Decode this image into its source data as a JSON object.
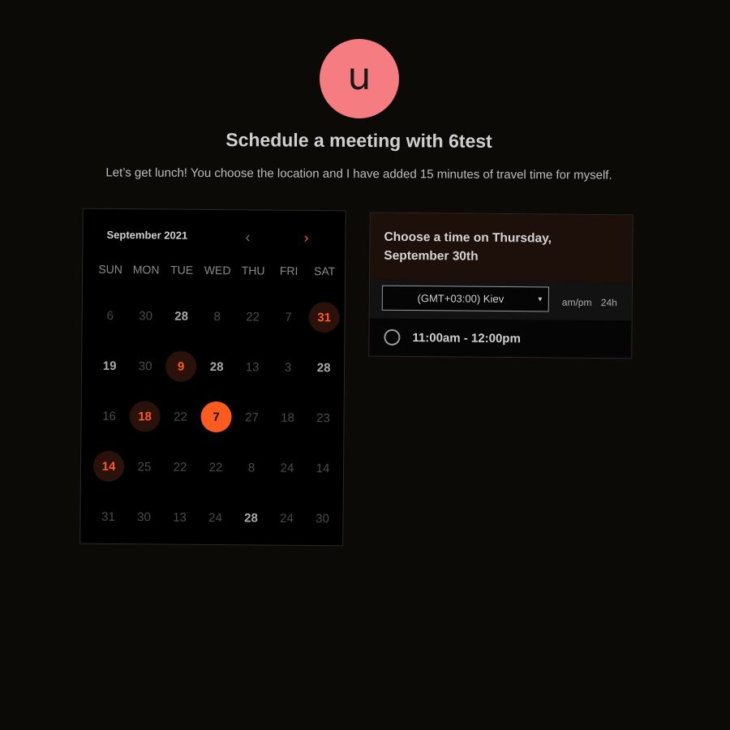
{
  "header": {
    "avatar_letter": "u",
    "title": "Schedule a meeting with 6test",
    "description": "Let’s get lunch! You choose the location and I have added 15 minutes of travel time for myself."
  },
  "calendar": {
    "month_label": "September 2021",
    "prev_icon": "chevron-left-icon",
    "next_icon": "chevron-right-icon",
    "weekdays": [
      "SUN",
      "MON",
      "TUE",
      "WED",
      "THU",
      "FRI",
      "SAT"
    ],
    "days": [
      {
        "label": "6",
        "state": "disabled"
      },
      {
        "label": "30",
        "state": "disabled"
      },
      {
        "label": "28",
        "state": "bold"
      },
      {
        "label": "8",
        "state": "disabled"
      },
      {
        "label": "22",
        "state": "disabled"
      },
      {
        "label": "7",
        "state": "disabled"
      },
      {
        "label": "31",
        "state": "available"
      },
      {
        "label": "19",
        "state": "bold"
      },
      {
        "label": "30",
        "state": "disabled"
      },
      {
        "label": "9",
        "state": "available"
      },
      {
        "label": "28",
        "state": "bold"
      },
      {
        "label": "13",
        "state": "disabled"
      },
      {
        "label": "3",
        "state": "disabled"
      },
      {
        "label": "28",
        "state": "bold"
      },
      {
        "label": "16",
        "state": "disabled"
      },
      {
        "label": "18",
        "state": "available"
      },
      {
        "label": "22",
        "state": "disabled"
      },
      {
        "label": "7",
        "state": "selected"
      },
      {
        "label": "27",
        "state": "disabled"
      },
      {
        "label": "18",
        "state": "disabled"
      },
      {
        "label": "23",
        "state": "disabled"
      },
      {
        "label": "14",
        "state": "available"
      },
      {
        "label": "25",
        "state": "disabled"
      },
      {
        "label": "22",
        "state": "disabled"
      },
      {
        "label": "22",
        "state": "disabled"
      },
      {
        "label": "8",
        "state": "disabled"
      },
      {
        "label": "24",
        "state": "disabled"
      },
      {
        "label": "14",
        "state": "disabled"
      },
      {
        "label": "31",
        "state": "disabled"
      },
      {
        "label": "30",
        "state": "disabled"
      },
      {
        "label": "13",
        "state": "disabled"
      },
      {
        "label": "24",
        "state": "disabled"
      },
      {
        "label": "28",
        "state": "bold"
      },
      {
        "label": "24",
        "state": "disabled"
      },
      {
        "label": "30",
        "state": "disabled"
      }
    ]
  },
  "time_panel": {
    "heading": "Choose a time on Thursday, September 30th",
    "timezone": "(GMT+03:00) Kiev",
    "format_ampm": "am/pm",
    "format_24h": "24h",
    "slots": [
      {
        "label": "11:00am - 12:00pm"
      }
    ]
  },
  "colors": {
    "accent": "#ff5a1f",
    "avatar": "#f57c80",
    "background": "#0c0a07"
  }
}
